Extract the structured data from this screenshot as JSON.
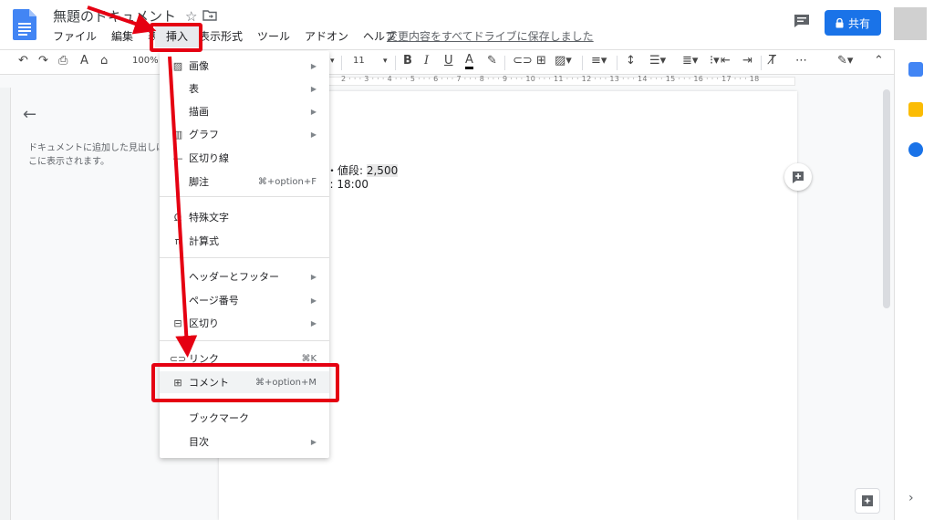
{
  "document": {
    "title": "無題のドキュメント",
    "save_status": "変更内容をすべてドライブに保存しました",
    "share_label": "共有"
  },
  "menubar": {
    "items": [
      "ファイル",
      "編集",
      "表示"
    ],
    "insert": "挿入",
    "items_after": [
      "表示形式",
      "ツール",
      "アドオン",
      "ヘルプ"
    ]
  },
  "toolbar": {
    "zoom": "100%",
    "font_size": "11",
    "bold": "B",
    "italic": "I",
    "underline": "U",
    "text_color": "A",
    "more": "⋯"
  },
  "ruler": {
    "numbers": "2 · · · 3 · · · 4 · · · 5 · · · 6 · · · 7 · · · 8 · · · 9 · · · 10 · · · 11 · · · 12 · · · 13 · · · 14 · · · 15 · · · 16 · · · 17 · · · 18"
  },
  "outline": {
    "hint": "ドキュメントに追加した見出しはここに表示されます。"
  },
  "page": {
    "line1_prefix": "・値段: ",
    "line1_value": "2,500",
    "line2": "J: 18:00"
  },
  "insert_menu": {
    "items": [
      {
        "icon": "▨",
        "label": "画像",
        "shortcut": "",
        "submenu": true
      },
      {
        "icon": "",
        "label": "表",
        "shortcut": "",
        "submenu": true
      },
      {
        "icon": "",
        "label": "描画",
        "shortcut": "",
        "submenu": true
      },
      {
        "icon": "▥",
        "label": "グラフ",
        "shortcut": "",
        "submenu": true
      },
      {
        "icon": "—",
        "label": "区切り線",
        "shortcut": "",
        "submenu": false
      },
      {
        "icon": "",
        "label": "脚注",
        "shortcut": "⌘+option+F",
        "submenu": false
      },
      {
        "icon": "Ω",
        "label": "特殊文字",
        "shortcut": "",
        "submenu": false
      },
      {
        "icon": "π",
        "label": "計算式",
        "shortcut": "",
        "submenu": false
      },
      {
        "icon": "",
        "label": "ヘッダーとフッター",
        "shortcut": "",
        "submenu": true
      },
      {
        "icon": "",
        "label": "ページ番号",
        "shortcut": "",
        "submenu": true
      },
      {
        "icon": "⊟",
        "label": "区切り",
        "shortcut": "",
        "submenu": true
      },
      {
        "icon": "⊂⊃",
        "label": "リンク",
        "shortcut": "⌘K",
        "submenu": false
      },
      {
        "icon": "⊞",
        "label": "コメント",
        "shortcut": "⌘+option+M",
        "submenu": false
      },
      {
        "icon": "",
        "label": "ブックマーク",
        "shortcut": "",
        "submenu": false
      },
      {
        "icon": "",
        "label": "目次",
        "shortcut": "",
        "submenu": true
      }
    ]
  },
  "colors": {
    "share_button": "#1a73e8",
    "annotation_red": "#e50012"
  }
}
